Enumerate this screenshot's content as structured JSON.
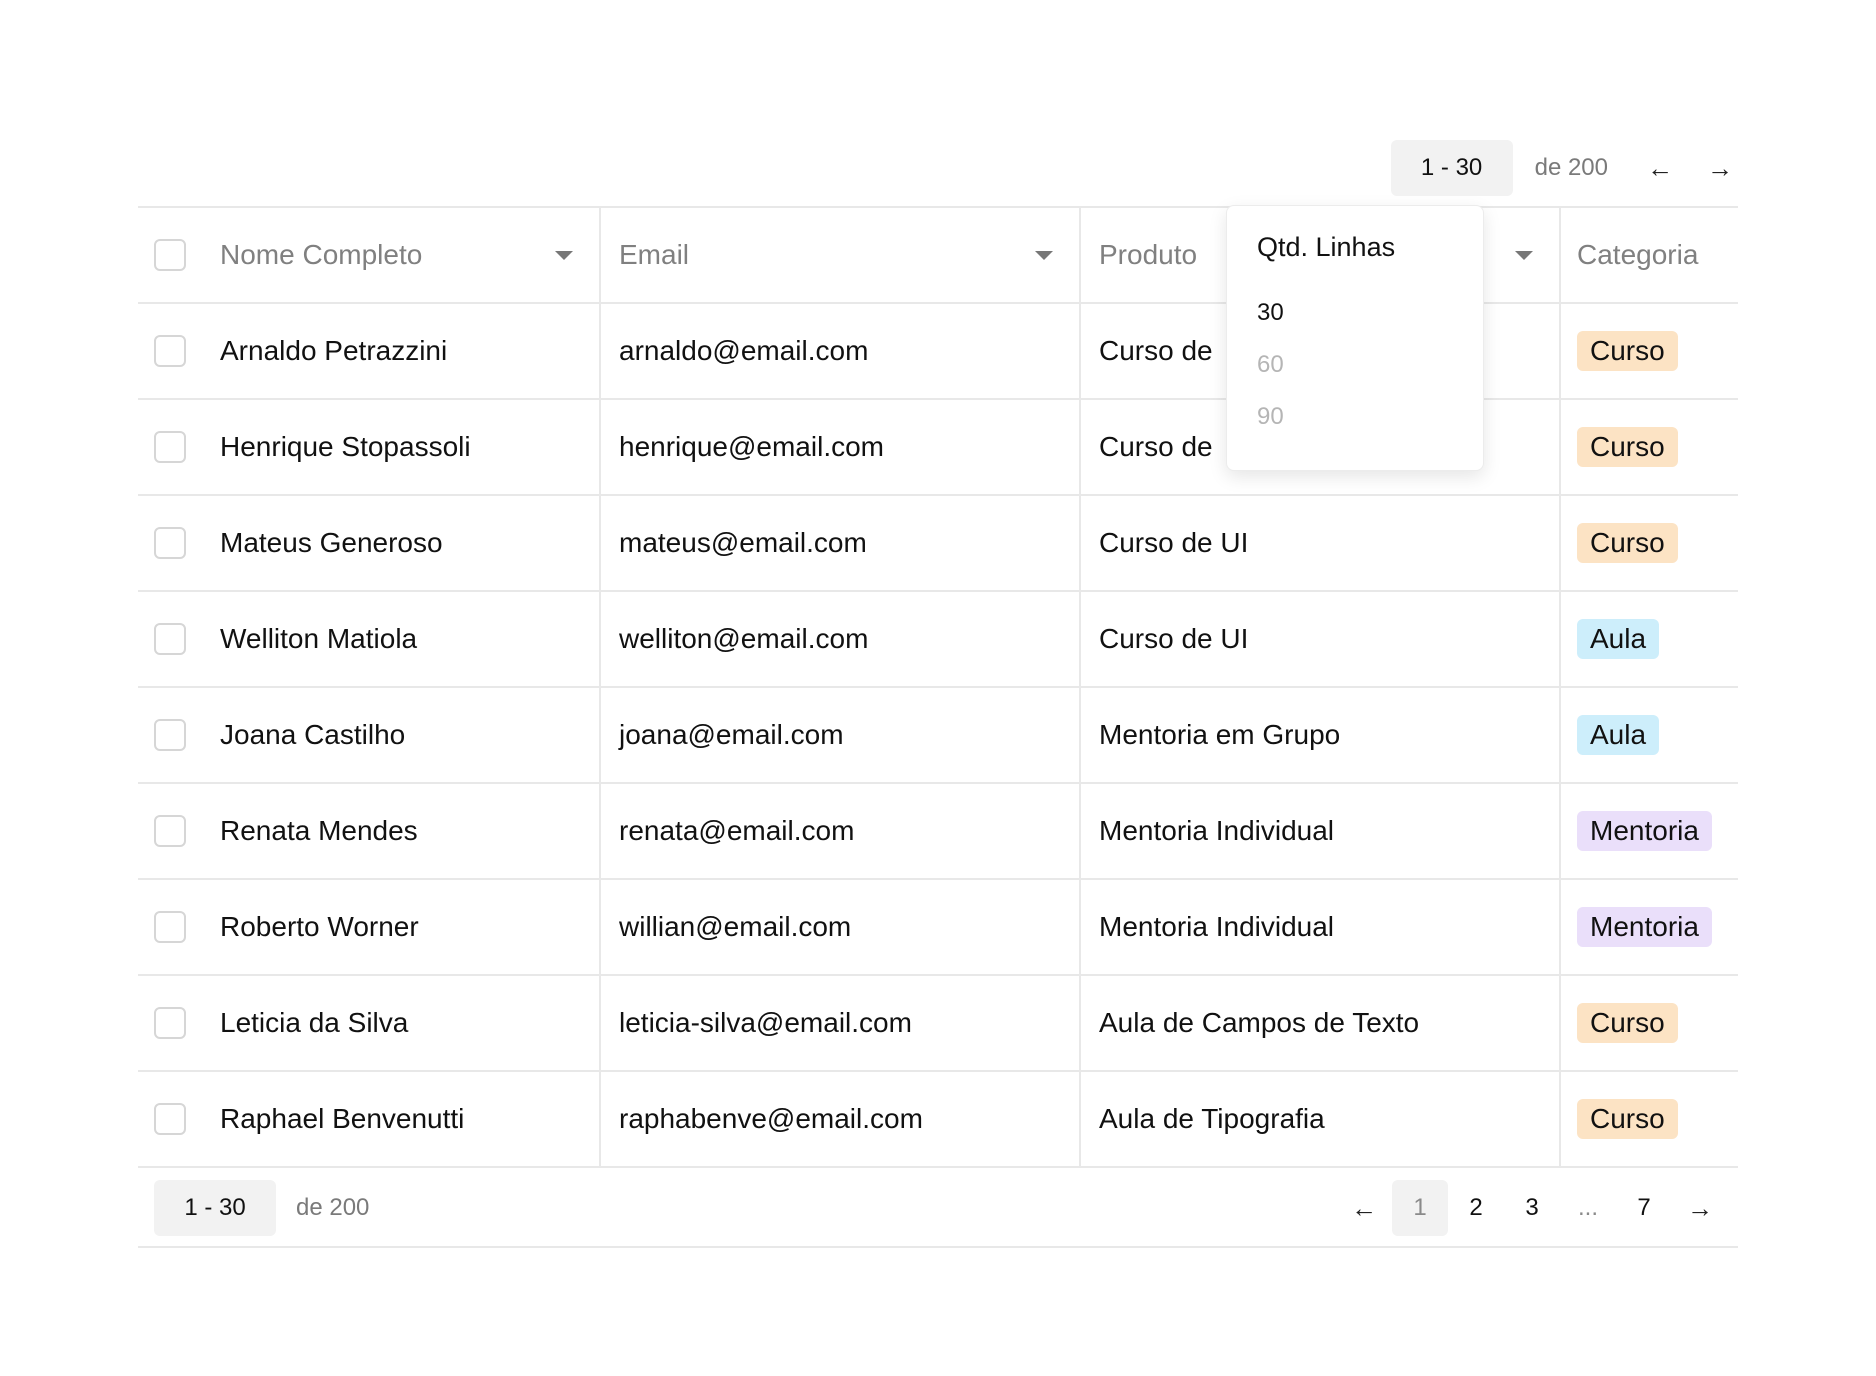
{
  "pager": {
    "range": "1 - 30",
    "of_total": "de 200",
    "prev_icon": "←",
    "next_icon": "→"
  },
  "table": {
    "columns": [
      {
        "label": "Nome Completo"
      },
      {
        "label": "Email"
      },
      {
        "label": "Produto"
      },
      {
        "label": "Categoria"
      }
    ],
    "rows": [
      {
        "name": "Arnaldo Petrazzini",
        "email": "arnaldo@email.com",
        "product": "Curso de",
        "category": "Curso"
      },
      {
        "name": "Henrique Stopassoli",
        "email": "henrique@email.com",
        "product": "Curso de",
        "category": "Curso"
      },
      {
        "name": "Mateus Generoso",
        "email": "mateus@email.com",
        "product": "Curso de UI",
        "category": "Curso"
      },
      {
        "name": "Welliton Matiola",
        "email": "welliton@email.com",
        "product": "Curso de UI",
        "category": "Aula"
      },
      {
        "name": "Joana Castilho",
        "email": "joana@email.com",
        "product": "Mentoria em Grupo",
        "category": "Aula"
      },
      {
        "name": "Renata Mendes",
        "email": "renata@email.com",
        "product": "Mentoria Individual",
        "category": "Mentoria"
      },
      {
        "name": "Roberto Worner",
        "email": "willian@email.com",
        "product": "Mentoria Individual",
        "category": "Mentoria"
      },
      {
        "name": "Leticia da Silva",
        "email": "leticia-silva@email.com",
        "product": "Aula de Campos de Texto",
        "category": "Curso"
      },
      {
        "name": "Raphael Benvenutti",
        "email": "raphabenve@email.com",
        "product": "Aula de Tipografia",
        "category": "Curso"
      }
    ]
  },
  "category_colors": {
    "Curso": "#fce3c4",
    "Aula": "#cdeefb",
    "Mentoria": "#eadffa"
  },
  "dropdown": {
    "title": "Qtd. Linhas",
    "options": [
      {
        "label": "30",
        "color": "#111111"
      },
      {
        "label": "60",
        "color": "#b5b5b5"
      },
      {
        "label": "90",
        "color": "#b5b5b5"
      }
    ]
  },
  "pagination": {
    "range": "1 - 30",
    "of_total": "de 200",
    "prev_icon": "←",
    "next_icon": "→",
    "pages": [
      "1",
      "2",
      "3",
      "...",
      "7"
    ],
    "active_page": "1"
  }
}
